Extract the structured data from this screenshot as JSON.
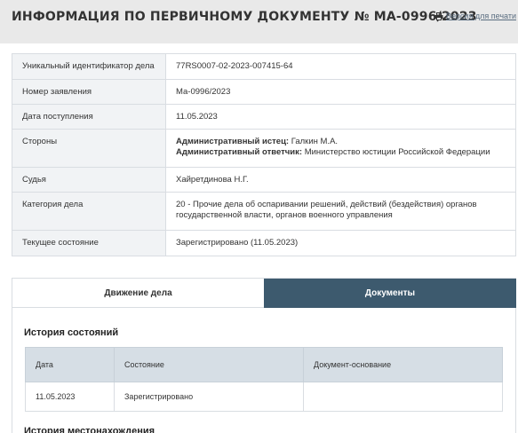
{
  "header": {
    "title": "ИНФОРМАЦИЯ ПО ПЕРВИЧНОМУ ДОКУМЕНТУ № МА-0996/2023",
    "print_link": "Версия для печати"
  },
  "info": {
    "rows": [
      {
        "label": "Уникальный идентификатор дела",
        "value": "77RS0007-02-2023-007415-64"
      },
      {
        "label": "Номер заявления",
        "value": "Ма-0996/2023"
      },
      {
        "label": "Дата поступления",
        "value": "11.05.2023"
      },
      {
        "label": "Стороны",
        "plaintiff_label": "Административный истец:",
        "plaintiff": "Галкин М.А.",
        "defendant_label": "Административный ответчик:",
        "defendant": "Министерство юстиции Российской Федерации"
      },
      {
        "label": "Судья",
        "value": "Хайретдинова Н.Г."
      },
      {
        "label": "Категория дела",
        "value": "20 - Прочие дела об оспаривании решений, действий (бездействия) органов государственной власти, органов военного управления"
      },
      {
        "label": "Текущее состояние",
        "value": "Зарегистрировано (11.05.2023)"
      }
    ]
  },
  "tabs": [
    {
      "label": "Движение дела",
      "active": false
    },
    {
      "label": "Документы",
      "active": true
    }
  ],
  "history": {
    "title": "История состояний",
    "columns": [
      "Дата",
      "Состояние",
      "Документ-основание"
    ],
    "rows": [
      {
        "date": "11.05.2023",
        "state": "Зарегистрировано",
        "basis": ""
      }
    ]
  },
  "location": {
    "title": "История местонахождения"
  },
  "colors": {
    "active_tab": "#3d5a6e",
    "header_bg": "#e9e9e9",
    "label_bg": "#f1f3f5",
    "table_head_bg": "#d6dee5"
  }
}
